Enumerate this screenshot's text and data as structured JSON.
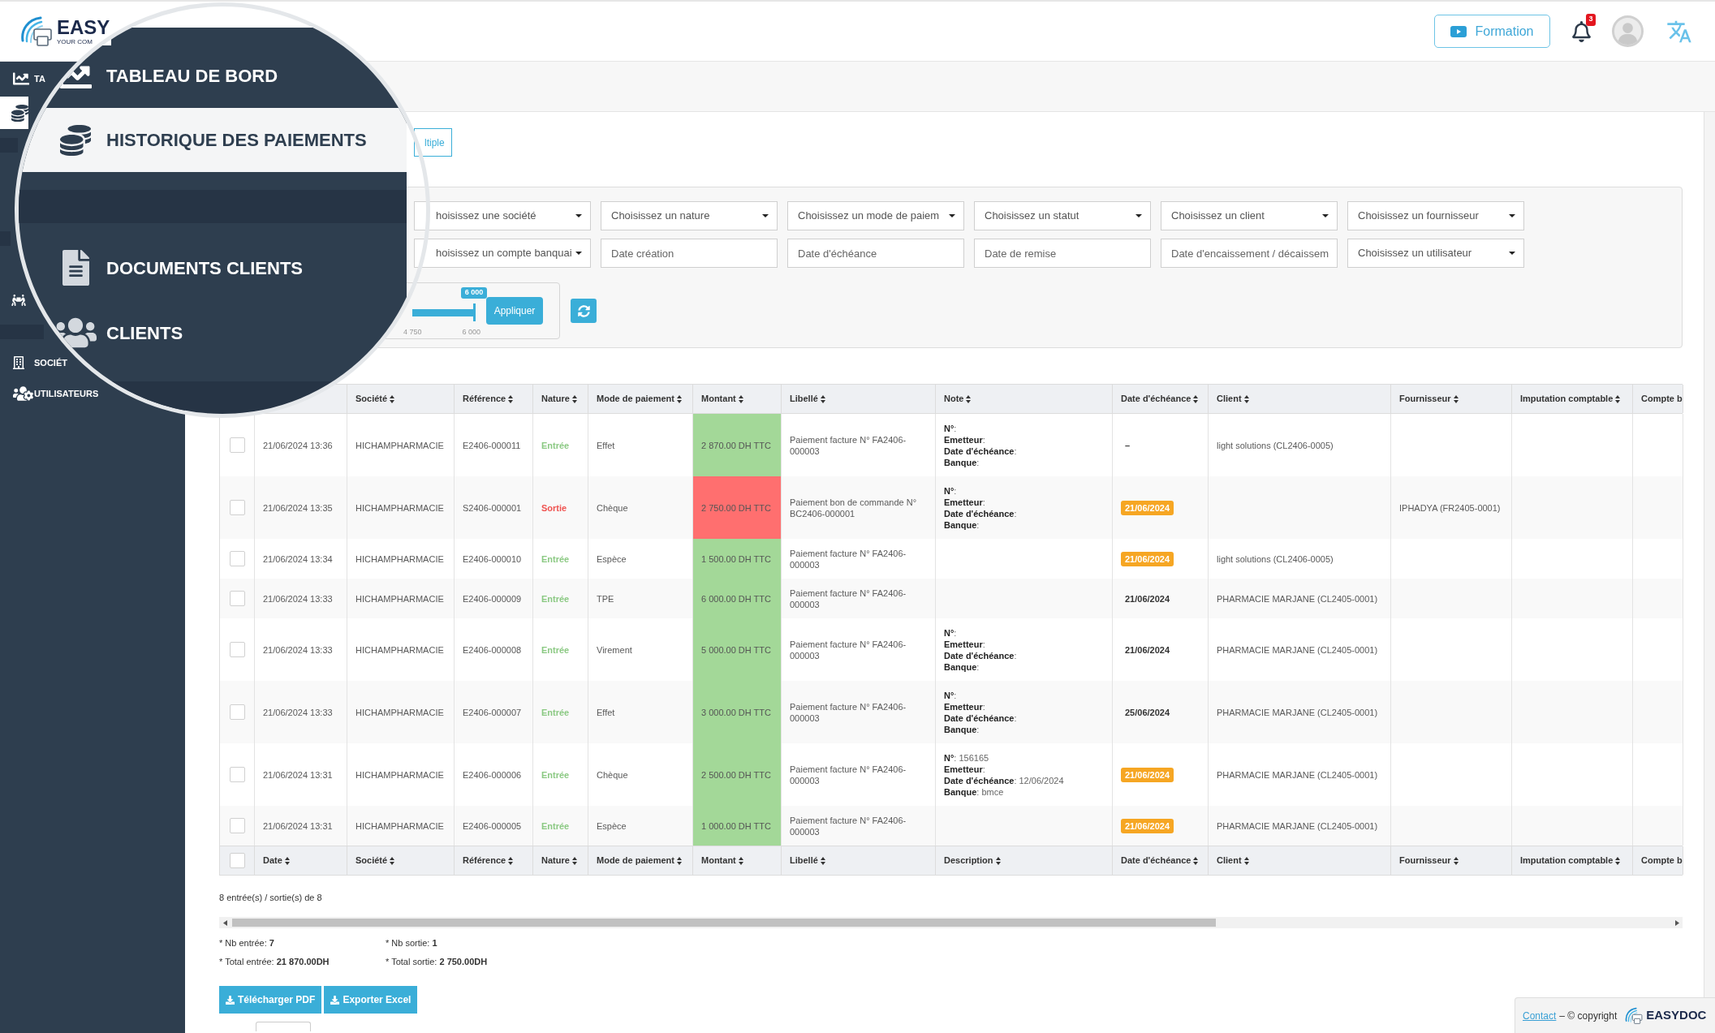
{
  "header": {
    "logo": {
      "name": "EASY",
      "tagline": "YOUR COM"
    },
    "training_button": "Formation",
    "notification_count": "3"
  },
  "sidebar": {
    "items": [
      {
        "kind": "dashboard",
        "label": "TA",
        "selected": false
      },
      {
        "kind": "payments",
        "selected": true
      }
    ],
    "tools": [
      {
        "kind": "delivery",
        "selected": false
      }
    ],
    "admin_items": [
      {
        "kind": "companies",
        "label": "SOCIÉT",
        "selected": false
      },
      {
        "kind": "users",
        "label": "UTILISATEURS",
        "selected": false
      }
    ]
  },
  "magnifier": {
    "items": [
      {
        "kind": "dashboard",
        "label": "TABLEAU DE BORD",
        "selected": false
      },
      {
        "kind": "payments",
        "label": "HISTORIQUE DES PAIEMENTS",
        "selected": true
      }
    ],
    "section_items": [
      {
        "kind": "documents",
        "label": "DOCUMENTS CLIENTS",
        "selected": false
      },
      {
        "kind": "clients",
        "label": "CLIENTS",
        "selected": false
      }
    ]
  },
  "toolbar": {
    "button": "ltiple"
  },
  "filters": {
    "rows": [
      [
        {
          "kind": "select",
          "placeholder": "hoisissez une société"
        },
        {
          "kind": "select",
          "placeholder": "Choisissez un nature"
        },
        {
          "kind": "select",
          "placeholder": "Choisissez un mode de paiem"
        },
        {
          "kind": "select",
          "placeholder": "Choisissez un statut"
        },
        {
          "kind": "select",
          "placeholder": "Choisissez un client"
        },
        {
          "kind": "select",
          "placeholder": "Choisissez un fournisseur"
        }
      ],
      [
        {
          "kind": "select",
          "placeholder": "hoisissez un compte banquai"
        },
        {
          "kind": "date",
          "placeholder": "Date création"
        },
        {
          "kind": "date",
          "placeholder": "Date d'échéance"
        },
        {
          "kind": "date",
          "placeholder": "Date de remise"
        },
        {
          "kind": "date",
          "placeholder": "Date d'encaissement / décaissem"
        },
        {
          "kind": "select",
          "placeholder": "Choisissez un utilisateur"
        }
      ]
    ],
    "slider": {
      "tooltip": "6 000",
      "level": 1,
      "ticks": [
        "4 750",
        "6 000"
      ]
    },
    "apply_button": "Appliquer"
  },
  "table": {
    "columns": [
      {
        "label": "Société",
        "sortable": true
      },
      {
        "label": "Référence",
        "sortable": true
      },
      {
        "label": "Nature",
        "sortable": true
      },
      {
        "label": "Mode de paiement",
        "sortable": true
      },
      {
        "label": "Montant",
        "sortable": true
      },
      {
        "label": "Libellé",
        "sortable": true
      },
      {
        "label": "Note",
        "sortable": true
      },
      {
        "label": "Date d'échéance",
        "sortable": true
      },
      {
        "label": "Client",
        "sortable": true
      },
      {
        "label": "Fournisseur",
        "sortable": true
      },
      {
        "label": "Imputation comptable",
        "sortable": true
      },
      {
        "label": "Compte b",
        "sortable": false
      }
    ],
    "rows": [
      {
        "checked": false,
        "date": "21/06/2024 13:36",
        "company": "HICHAMPHARMACIE",
        "reference": "E2406-000011",
        "nature": "Entrée",
        "kind": "in",
        "payment_mode": "Effet",
        "amount": "2 870.00 DH TTC",
        "label": "Paiement facture N° FA2406-000003",
        "note": [
          "**N°**:",
          "**Emetteur**:",
          "**Date d'échéance**:",
          "**Banque**:"
        ],
        "due_date": {
          "kind": "plain",
          "text": "–"
        },
        "client": "light solutions (CL2406-0005)"
      },
      {
        "checked": false,
        "date": "21/06/2024 13:35",
        "company": "HICHAMPHARMACIE",
        "reference": "S2406-000001",
        "nature": "Sortie",
        "kind": "out",
        "payment_mode": "Chèque",
        "amount": "2 750.00 DH TTC",
        "label": "Paiement bon de commande N° BC2406-000001",
        "note": [
          "**N°**:",
          "**Emetteur**:",
          "**Date d'échéance**:",
          "**Banque**:"
        ],
        "due_date": {
          "kind": "badge",
          "text": "21/06/2024"
        },
        "supplier": "IPHADYA (FR2405-0001)"
      },
      {
        "checked": false,
        "date": "21/06/2024 13:34",
        "company": "HICHAMPHARMACIE",
        "reference": "E2406-000010",
        "nature": "Entrée",
        "kind": "in",
        "payment_mode": "Espèce",
        "amount": "1 500.00 DH TTC",
        "label": "Paiement facture N° FA2406-000003",
        "due_date": {
          "kind": "badge",
          "text": "21/06/2024"
        },
        "client": "light solutions (CL2406-0005)"
      },
      {
        "checked": false,
        "date": "21/06/2024 13:33",
        "company": "HICHAMPHARMACIE",
        "reference": "E2406-000009",
        "nature": "Entrée",
        "kind": "in",
        "payment_mode": "TPE",
        "amount": "6 000.00 DH TTC",
        "label": "Paiement facture N° FA2406-000003",
        "due_date": {
          "kind": "plain",
          "text": "21/06/2024"
        },
        "client": "PHARMACIE MARJANE (CL2405-0001)"
      },
      {
        "checked": false,
        "date": "21/06/2024 13:33",
        "company": "HICHAMPHARMACIE",
        "reference": "E2406-000008",
        "nature": "Entrée",
        "kind": "in",
        "payment_mode": "Virement",
        "amount": "5 000.00 DH TTC",
        "label": "Paiement facture N° FA2406-000003",
        "note": [
          "**N°**:",
          "**Emetteur**:",
          "**Date d'échéance**:",
          "**Banque**:"
        ],
        "due_date": {
          "kind": "plain",
          "text": "21/06/2024"
        },
        "client": "PHARMACIE MARJANE (CL2405-0001)"
      },
      {
        "checked": false,
        "date": "21/06/2024 13:33",
        "company": "HICHAMPHARMACIE",
        "reference": "E2406-000007",
        "nature": "Entrée",
        "kind": "in",
        "payment_mode": "Effet",
        "amount": "3 000.00 DH TTC",
        "label": "Paiement facture N° FA2406-000003",
        "note": [
          "**N°**:",
          "**Emetteur**:",
          "**Date d'échéance**:",
          "**Banque**:"
        ],
        "due_date": {
          "kind": "plain",
          "text": "25/06/2024"
        },
        "client": "PHARMACIE MARJANE (CL2405-0001)"
      },
      {
        "checked": false,
        "date": "21/06/2024 13:31",
        "company": "HICHAMPHARMACIE",
        "reference": "E2406-000006",
        "nature": "Entrée",
        "kind": "in",
        "payment_mode": "Chèque",
        "amount": "2 500.00 DH TTC",
        "label": "Paiement facture N° FA2406-000003",
        "note": [
          "**N°**: 156165",
          "**Emetteur**:",
          "**Date d'échéance**: 12/06/2024",
          "**Banque**: bmce"
        ],
        "due_date": {
          "kind": "badge",
          "text": "21/06/2024"
        },
        "client": "PHARMACIE MARJANE (CL2405-0001)"
      },
      {
        "checked": false,
        "date": "21/06/2024 13:31",
        "company": "HICHAMPHARMACIE",
        "reference": "E2406-000005",
        "nature": "Entrée",
        "kind": "in",
        "payment_mode": "Espèce",
        "amount": "1 000.00 DH TTC",
        "label": "Paiement facture N° FA2406-000003",
        "due_date": {
          "kind": "badge",
          "text": "21/06/2024"
        },
        "client": "PHARMACIE MARJANE (CL2405-0001)"
      }
    ],
    "footer": {
      "checked": false,
      "columns": [
        {
          "label": "Date",
          "sortable": true
        },
        {
          "label": "Société",
          "sortable": true
        },
        {
          "label": "Référence",
          "sortable": true
        },
        {
          "label": "Nature",
          "sortable": true
        },
        {
          "label": "Mode de paiement",
          "sortable": true
        },
        {
          "label": "Montant",
          "sortable": true
        },
        {
          "label": "Libellé",
          "sortable": true
        },
        {
          "label": "Description",
          "sortable": true
        },
        {
          "label": "Date d'échéance",
          "sortable": true
        },
        {
          "label": "Client",
          "sortable": true
        },
        {
          "label": "Fournisseur",
          "sortable": true
        },
        {
          "label": "Imputation comptable",
          "sortable": true
        },
        {
          "label": "Compte b",
          "sortable": false
        }
      ]
    }
  },
  "summary": {
    "count": "8 entrée(s) / sortie(s) de 8",
    "stats": [
      "* Nb entrée: **7**",
      "* Nb sortie: **1**",
      "* Total entrée: **21 870.00DH**",
      "* Total sortie: **2 750.00DH**"
    ]
  },
  "buttons": [
    "Télécharger PDF",
    "Exporter Excel"
  ],
  "footer": {
    "link": "Contact",
    "text": "– © copyright",
    "logo": "EASYDOC"
  }
}
